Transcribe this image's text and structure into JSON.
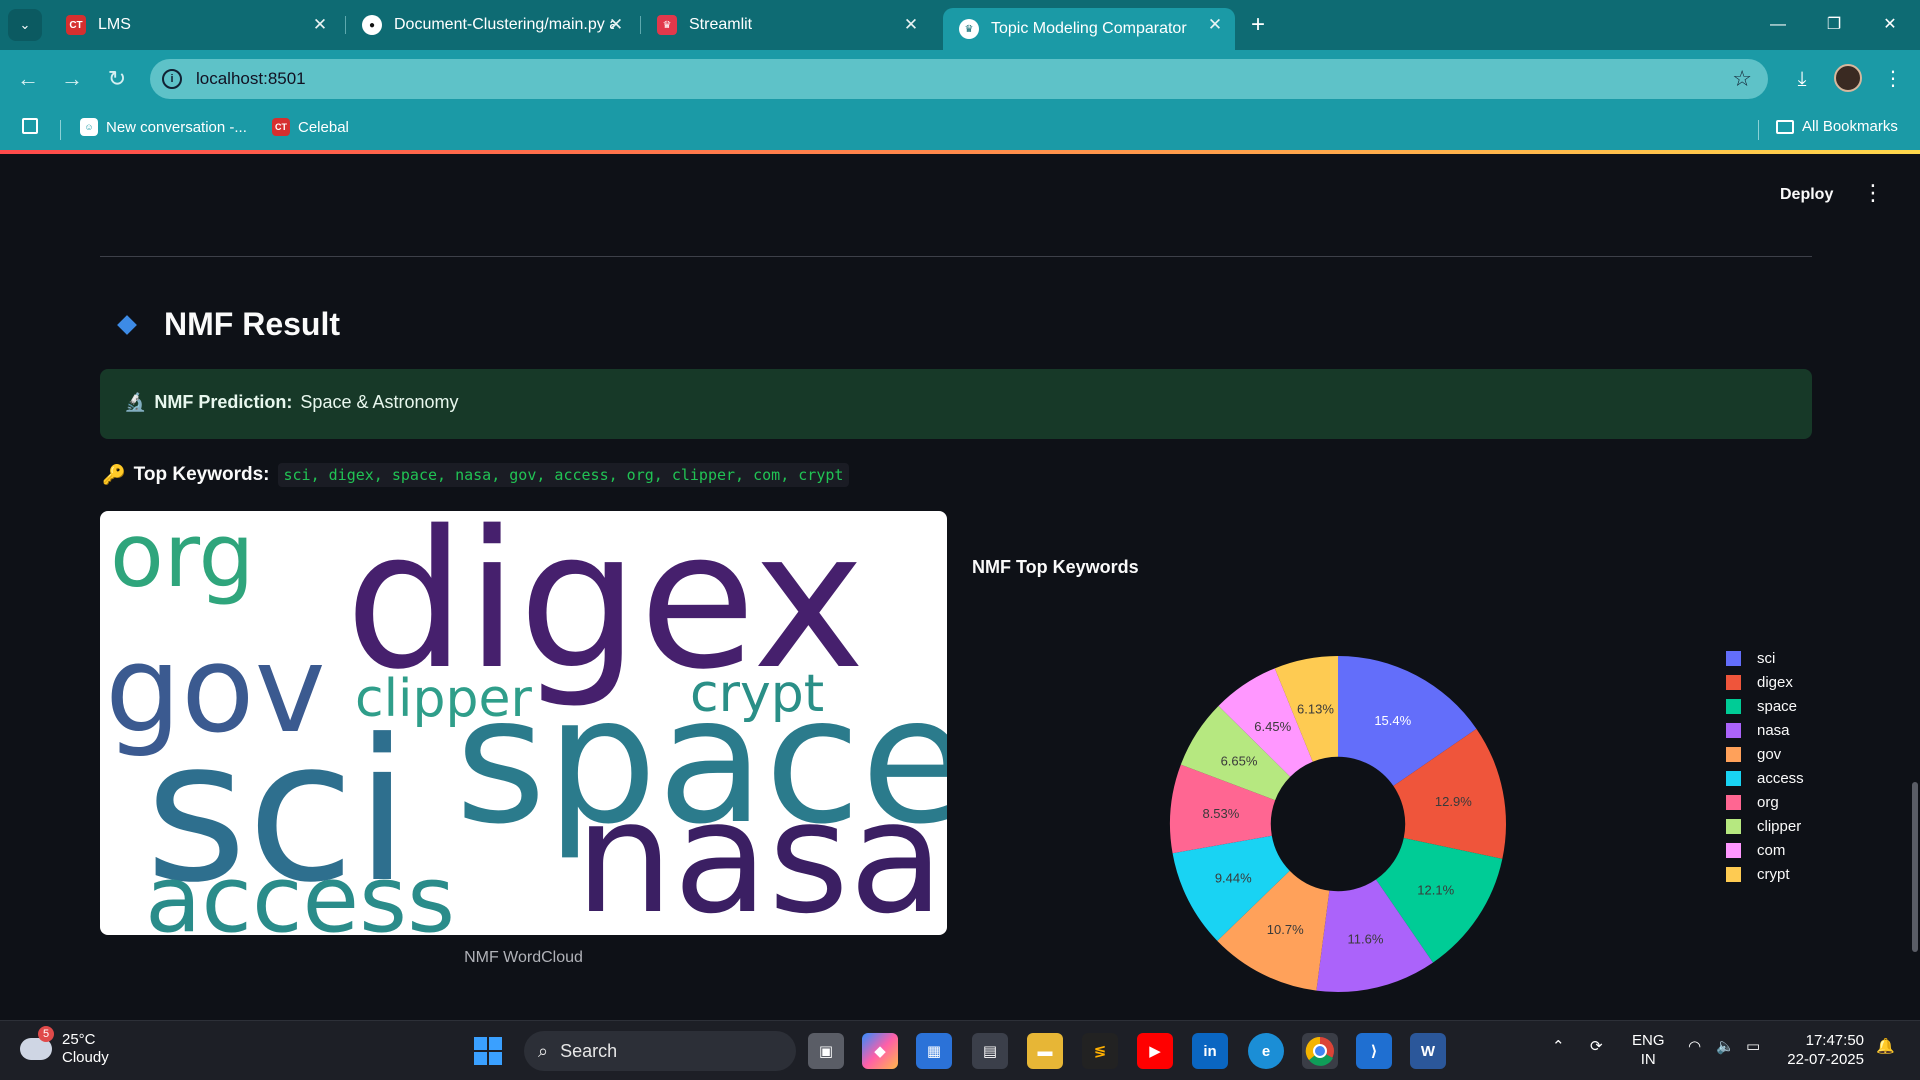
{
  "browser": {
    "tabs": [
      {
        "label": "LMS",
        "favicon": "lms-favicon"
      },
      {
        "label": "Document-Clustering/main.py a",
        "favicon": "github-icon"
      },
      {
        "label": "Streamlit",
        "favicon": "streamlit-icon"
      },
      {
        "label": "Topic Modeling Comparator",
        "favicon": "streamlit-crown-icon",
        "active": true
      }
    ],
    "url": "localhost:8501",
    "bookmarks": [
      {
        "label": "New conversation -..."
      },
      {
        "label": "Celebal"
      }
    ],
    "all_bookmarks": "All Bookmarks"
  },
  "app": {
    "deploy_label": "Deploy",
    "section_title": "NMF Result",
    "prediction_label": "NMF Prediction:",
    "prediction_value": "Space & Astronomy",
    "keywords_label": "Top Keywords:",
    "keywords_value": "sci, digex, space, nasa, gov, access, org, clipper, com, crypt",
    "wordcloud_caption": "NMF WordCloud",
    "wordcloud_words": [
      "digex",
      "org",
      "gov",
      "clipper",
      "crypt",
      "sci",
      "space",
      "nasa",
      "access"
    ]
  },
  "chart_data": {
    "type": "pie",
    "title": "NMF Top Keywords",
    "hole": 0.4,
    "legend_position": "right",
    "categories": [
      "sci",
      "digex",
      "space",
      "nasa",
      "gov",
      "access",
      "org",
      "clipper",
      "com",
      "crypt"
    ],
    "values": [
      15.4,
      12.9,
      12.1,
      11.6,
      10.7,
      9.44,
      8.53,
      6.65,
      6.45,
      6.13
    ],
    "labels": [
      "15.4%",
      "12.9%",
      "12.1%",
      "11.6%",
      "10.7%",
      "9.44%",
      "8.53%",
      "6.65%",
      "6.45%",
      "6.13%"
    ],
    "colors": [
      "#636efa",
      "#ef553b",
      "#00cc96",
      "#ab63fa",
      "#ffa15a",
      "#19d3f3",
      "#ff6692",
      "#b6e880",
      "#ff97ff",
      "#fecb52"
    ]
  },
  "taskbar": {
    "temperature": "25°C",
    "weather": "Cloudy",
    "weather_badge": "5",
    "search_placeholder": "Search",
    "lang_line1": "ENG",
    "lang_line2": "IN",
    "time": "17:47:50",
    "date": "22-07-2025"
  }
}
